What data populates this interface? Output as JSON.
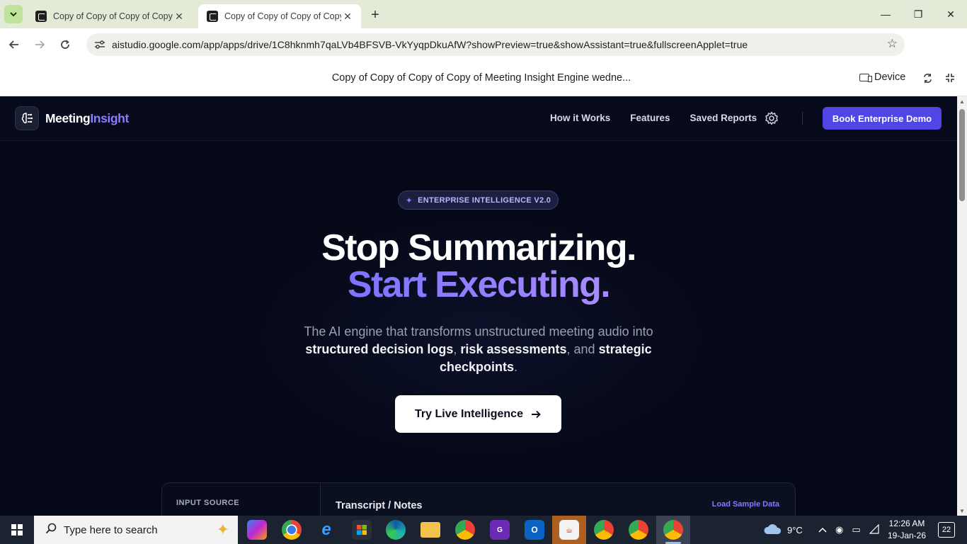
{
  "browser": {
    "tabs": [
      {
        "title": "Copy of Copy of Copy of Copy of Meeting Insight Engine wednesday",
        "active": false
      },
      {
        "title": "Copy of Copy of Copy of Copy of Meeting Insight Engine wednesday",
        "active": true
      }
    ],
    "new_tab_icon": "plus-icon",
    "url": "aistudio.google.com/app/apps/drive/1C8hknmh7qaLVb4BFSVB-VkYyqpDkuAfW?showPreview=true&showAssistant=true&fullscreenApplet=true"
  },
  "applet_bar": {
    "title": "Copy of Copy of Copy of Copy of Meeting Insight Engine wedne...",
    "device_label": "Device"
  },
  "app": {
    "logo": {
      "word1": "Meeting",
      "word2": "Insight"
    },
    "nav": {
      "links": [
        "How it Works",
        "Features",
        "Saved Reports"
      ],
      "cta": "Book Enterprise Demo"
    },
    "badge": "ENTERPRISE INTELLIGENCE V2.0",
    "hero": {
      "line1": "Stop Summarizing.",
      "line2": "Start Executing."
    },
    "subhead": {
      "p1": "The AI engine that transforms unstructured meeting audio into ",
      "b1": "structured decision logs",
      "p2": ", ",
      "b2": "risk assessments",
      "p3": ", and ",
      "b3": "strategic checkpoints",
      "p4": "."
    },
    "cta": "Try Live Intelligence",
    "panel": {
      "input_label": "INPUT SOURCE",
      "transcript_title": "Transcript / Notes",
      "load_sample": "Load Sample Data"
    },
    "colors": {
      "background": "#050816",
      "accent": "#4f46e5",
      "accent_light": "#8b7dff"
    }
  },
  "taskbar": {
    "search_placeholder": "Type here to search",
    "weather": "9°C",
    "time": "12:26 AM",
    "date": "19-Jan-26",
    "notifications": "22"
  }
}
